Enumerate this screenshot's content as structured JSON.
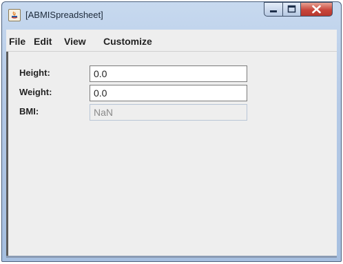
{
  "window": {
    "title": "[ABMISpreadsheet]"
  },
  "menubar": {
    "items": [
      "File",
      "Edit",
      "View",
      "Customize"
    ]
  },
  "form": {
    "height": {
      "label": "Height:",
      "value": "0.0"
    },
    "weight": {
      "label": "Weight:",
      "value": "0.0"
    },
    "bmi": {
      "label": "BMI:",
      "value": "NaN"
    }
  }
}
